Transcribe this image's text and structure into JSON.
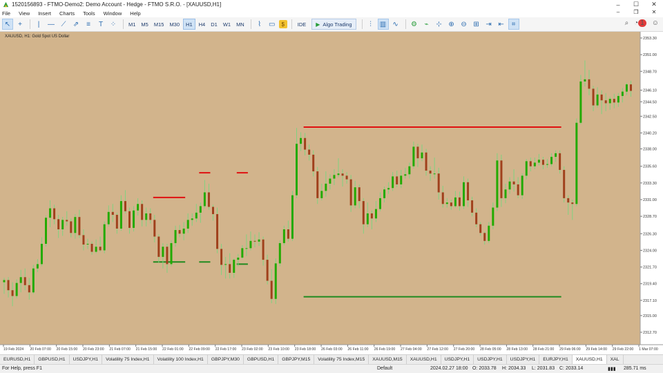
{
  "window": {
    "title": "1520156893 - FTMO-Demo2: Demo Account - Hedge - FTMO S.R.O. - [XAUUSD,H1]",
    "controls": [
      "–",
      "☐",
      "✕"
    ]
  },
  "menu": {
    "items": [
      "File",
      "View",
      "Insert",
      "Charts",
      "Tools",
      "Window",
      "Help"
    ],
    "right_controls": [
      "–",
      "❐",
      "✕"
    ]
  },
  "toolbar": {
    "timeframes": [
      "M1",
      "M5",
      "M15",
      "M30",
      "H1",
      "H4",
      "D1",
      "W1",
      "MN"
    ],
    "active_timeframe": "H1",
    "ide_label": "IDE",
    "algo_label": "Algo Trading",
    "notification_count": "1"
  },
  "chart": {
    "symbol_label": "XAUUSD, H1:  Gold Spot US Dollar",
    "background": "#d2b48c",
    "bull_color": "#22aa00",
    "bear_color": "#a0401c",
    "wick_color": "#7fd27f",
    "price_levels": [
      "2353.30",
      "2351.00",
      "2348.70",
      "2346.10",
      "2344.50",
      "2342.50",
      "2340.20",
      "2338.00",
      "2335.60",
      "2333.30",
      "2331.00",
      "2328.70",
      "2326.30",
      "2324.00",
      "2321.70",
      "2319.40",
      "2317.10",
      "2315.00",
      "2312.70"
    ],
    "time_labels": [
      "19 Feb 2024",
      "20 Feb 07:00",
      "20 Feb 15:00",
      "20 Feb 23:00",
      "21 Feb 07:00",
      "21 Feb 15:00",
      "22 Feb 01:00",
      "22 Feb 09:00",
      "22 Feb 17:00",
      "23 Feb 02:00",
      "23 Feb 10:00",
      "23 Feb 18:00",
      "26 Feb 03:00",
      "26 Feb 11:00",
      "26 Feb 19:00",
      "27 Feb 04:00",
      "27 Feb 12:00",
      "27 Feb 20:00",
      "28 Feb 05:00",
      "28 Feb 13:00",
      "28 Feb 21:00",
      "29 Feb 06:00",
      "29 Feb 14:00",
      "29 Feb 22:00",
      "1 Mar 07:00"
    ],
    "candles": [
      {
        "o": 2319.6,
        "h": 2320.2,
        "l": 2318.0,
        "c": 2319.9
      },
      {
        "o": 2319.9,
        "h": 2320.3,
        "l": 2317.5,
        "c": 2318.5
      },
      {
        "o": 2318.5,
        "h": 2319.6,
        "l": 2316.3,
        "c": 2317.7
      },
      {
        "o": 2317.7,
        "h": 2320.0,
        "l": 2317.4,
        "c": 2319.5
      },
      {
        "o": 2319.5,
        "h": 2321.3,
        "l": 2318.2,
        "c": 2320.3
      },
      {
        "o": 2320.3,
        "h": 2321.5,
        "l": 2318.5,
        "c": 2319.2
      },
      {
        "o": 2319.2,
        "h": 2320.2,
        "l": 2317.2,
        "c": 2318.2
      },
      {
        "o": 2318.2,
        "h": 2322.0,
        "l": 2318.0,
        "c": 2321.5
      },
      {
        "o": 2321.5,
        "h": 2322.8,
        "l": 2321.0,
        "c": 2322.1
      },
      {
        "o": 2322.1,
        "h": 2325.8,
        "l": 2321.8,
        "c": 2324.9
      },
      {
        "o": 2324.9,
        "h": 2328.8,
        "l": 2324.5,
        "c": 2328.5
      },
      {
        "o": 2328.5,
        "h": 2330.9,
        "l": 2327.2,
        "c": 2329.8
      },
      {
        "o": 2329.8,
        "h": 2330.3,
        "l": 2327.6,
        "c": 2328.3
      },
      {
        "o": 2328.3,
        "h": 2328.9,
        "l": 2325.7,
        "c": 2326.9
      },
      {
        "o": 2326.9,
        "h": 2328.6,
        "l": 2326.0,
        "c": 2328.2
      },
      {
        "o": 2328.2,
        "h": 2329.4,
        "l": 2327.4,
        "c": 2328.0
      },
      {
        "o": 2328.0,
        "h": 2328.4,
        "l": 2325.8,
        "c": 2326.4
      },
      {
        "o": 2326.4,
        "h": 2329.0,
        "l": 2325.6,
        "c": 2328.6
      },
      {
        "o": 2328.6,
        "h": 2329.6,
        "l": 2325.7,
        "c": 2326.1
      },
      {
        "o": 2326.1,
        "h": 2326.9,
        "l": 2324.0,
        "c": 2324.8
      },
      {
        "o": 2324.8,
        "h": 2325.6,
        "l": 2324.2,
        "c": 2324.9
      },
      {
        "o": 2324.9,
        "h": 2325.2,
        "l": 2323.4,
        "c": 2323.8
      },
      {
        "o": 2323.8,
        "h": 2325.5,
        "l": 2323.6,
        "c": 2324.5
      },
      {
        "o": 2324.5,
        "h": 2325.9,
        "l": 2323.8,
        "c": 2324.0
      },
      {
        "o": 2324.0,
        "h": 2328.0,
        "l": 2323.6,
        "c": 2327.6
      },
      {
        "o": 2327.6,
        "h": 2330.2,
        "l": 2327.3,
        "c": 2329.3
      },
      {
        "o": 2329.3,
        "h": 2330.4,
        "l": 2327.9,
        "c": 2328.9
      },
      {
        "o": 2328.9,
        "h": 2329.2,
        "l": 2326.3,
        "c": 2327.0
      },
      {
        "o": 2327.0,
        "h": 2331.6,
        "l": 2326.7,
        "c": 2330.8
      },
      {
        "o": 2330.8,
        "h": 2332.3,
        "l": 2329.1,
        "c": 2329.4
      },
      {
        "o": 2329.4,
        "h": 2329.9,
        "l": 2326.3,
        "c": 2327.1
      },
      {
        "o": 2327.1,
        "h": 2330.1,
        "l": 2326.6,
        "c": 2329.5
      },
      {
        "o": 2329.5,
        "h": 2331.2,
        "l": 2328.8,
        "c": 2330.4
      },
      {
        "o": 2330.4,
        "h": 2330.9,
        "l": 2327.3,
        "c": 2328.2
      },
      {
        "o": 2328.2,
        "h": 2329.9,
        "l": 2327.3,
        "c": 2329.1
      },
      {
        "o": 2329.1,
        "h": 2329.8,
        "l": 2327.7,
        "c": 2328.2
      },
      {
        "o": 2328.2,
        "h": 2328.9,
        "l": 2325.1,
        "c": 2325.9
      },
      {
        "o": 2325.9,
        "h": 2326.2,
        "l": 2322.3,
        "c": 2323.1
      },
      {
        "o": 2323.1,
        "h": 2325.0,
        "l": 2321.5,
        "c": 2324.5
      },
      {
        "o": 2324.5,
        "h": 2324.9,
        "l": 2320.9,
        "c": 2322.1
      },
      {
        "o": 2322.1,
        "h": 2325.4,
        "l": 2321.8,
        "c": 2325.0
      },
      {
        "o": 2325.0,
        "h": 2327.4,
        "l": 2324.5,
        "c": 2326.8
      },
      {
        "o": 2326.8,
        "h": 2327.5,
        "l": 2325.8,
        "c": 2326.3
      },
      {
        "o": 2326.3,
        "h": 2327.9,
        "l": 2325.4,
        "c": 2327.0
      },
      {
        "o": 2327.0,
        "h": 2329.1,
        "l": 2326.4,
        "c": 2328.2
      },
      {
        "o": 2328.2,
        "h": 2329.1,
        "l": 2327.4,
        "c": 2328.4
      },
      {
        "o": 2328.4,
        "h": 2330.4,
        "l": 2327.9,
        "c": 2329.2
      },
      {
        "o": 2329.2,
        "h": 2330.6,
        "l": 2327.8,
        "c": 2330.1
      },
      {
        "o": 2330.1,
        "h": 2333.7,
        "l": 2329.8,
        "c": 2332.0
      },
      {
        "o": 2332.0,
        "h": 2333.2,
        "l": 2329.6,
        "c": 2330.0
      },
      {
        "o": 2330.0,
        "h": 2330.3,
        "l": 2328.1,
        "c": 2329.0
      },
      {
        "o": 2329.0,
        "h": 2329.9,
        "l": 2323.6,
        "c": 2324.2
      },
      {
        "o": 2324.2,
        "h": 2324.9,
        "l": 2320.6,
        "c": 2322.0
      },
      {
        "o": 2322.0,
        "h": 2323.1,
        "l": 2320.1,
        "c": 2322.1
      },
      {
        "o": 2322.1,
        "h": 2323.6,
        "l": 2320.1,
        "c": 2320.9
      },
      {
        "o": 2320.9,
        "h": 2322.9,
        "l": 2320.2,
        "c": 2322.7
      },
      {
        "o": 2322.7,
        "h": 2323.5,
        "l": 2321.8,
        "c": 2323.0
      },
      {
        "o": 2323.0,
        "h": 2324.7,
        "l": 2322.8,
        "c": 2324.3
      },
      {
        "o": 2324.3,
        "h": 2326.2,
        "l": 2323.2,
        "c": 2324.3
      },
      {
        "o": 2324.3,
        "h": 2326.6,
        "l": 2324.0,
        "c": 2325.3
      },
      {
        "o": 2325.3,
        "h": 2326.2,
        "l": 2324.4,
        "c": 2325.2
      },
      {
        "o": 2325.2,
        "h": 2326.5,
        "l": 2324.6,
        "c": 2325.5
      },
      {
        "o": 2325.5,
        "h": 2325.9,
        "l": 2321.9,
        "c": 2322.7
      },
      {
        "o": 2322.7,
        "h": 2323.4,
        "l": 2319.3,
        "c": 2319.8
      },
      {
        "o": 2319.8,
        "h": 2321.4,
        "l": 2316.7,
        "c": 2317.3
      },
      {
        "o": 2317.3,
        "h": 2322.9,
        "l": 2316.6,
        "c": 2322.2
      },
      {
        "o": 2322.2,
        "h": 2325.4,
        "l": 2321.8,
        "c": 2325.0
      },
      {
        "o": 2325.0,
        "h": 2327.4,
        "l": 2324.7,
        "c": 2326.9
      },
      {
        "o": 2326.9,
        "h": 2328.1,
        "l": 2325.2,
        "c": 2325.6
      },
      {
        "o": 2325.6,
        "h": 2332.2,
        "l": 2325.3,
        "c": 2331.6
      },
      {
        "o": 2331.6,
        "h": 2340.9,
        "l": 2331.2,
        "c": 2338.7
      },
      {
        "o": 2338.7,
        "h": 2340.3,
        "l": 2337.7,
        "c": 2339.5
      },
      {
        "o": 2339.5,
        "h": 2340.2,
        "l": 2337.1,
        "c": 2337.9
      },
      {
        "o": 2337.9,
        "h": 2338.6,
        "l": 2336.4,
        "c": 2337.2
      },
      {
        "o": 2337.2,
        "h": 2337.8,
        "l": 2334.2,
        "c": 2334.9
      },
      {
        "o": 2334.9,
        "h": 2335.5,
        "l": 2330.4,
        "c": 2331.2
      },
      {
        "o": 2331.2,
        "h": 2333.2,
        "l": 2330.9,
        "c": 2332.2
      },
      {
        "o": 2332.2,
        "h": 2334.9,
        "l": 2331.4,
        "c": 2333.2
      },
      {
        "o": 2333.2,
        "h": 2334.5,
        "l": 2332.4,
        "c": 2333.9
      },
      {
        "o": 2333.9,
        "h": 2335.2,
        "l": 2333.0,
        "c": 2334.4
      },
      {
        "o": 2334.4,
        "h": 2336.7,
        "l": 2334.1,
        "c": 2334.6
      },
      {
        "o": 2334.6,
        "h": 2335.2,
        "l": 2332.8,
        "c": 2334.3
      },
      {
        "o": 2334.3,
        "h": 2334.8,
        "l": 2333.2,
        "c": 2333.8
      },
      {
        "o": 2333.8,
        "h": 2334.4,
        "l": 2329.3,
        "c": 2330.2
      },
      {
        "o": 2330.2,
        "h": 2333.6,
        "l": 2329.8,
        "c": 2332.7
      },
      {
        "o": 2332.7,
        "h": 2333.1,
        "l": 2329.8,
        "c": 2330.8
      },
      {
        "o": 2330.8,
        "h": 2331.2,
        "l": 2326.3,
        "c": 2327.6
      },
      {
        "o": 2327.6,
        "h": 2330.6,
        "l": 2327.2,
        "c": 2329.1
      },
      {
        "o": 2329.1,
        "h": 2329.5,
        "l": 2326.9,
        "c": 2328.4
      },
      {
        "o": 2328.4,
        "h": 2330.8,
        "l": 2327.9,
        "c": 2329.7
      },
      {
        "o": 2329.7,
        "h": 2332.0,
        "l": 2329.4,
        "c": 2331.2
      },
      {
        "o": 2331.2,
        "h": 2332.8,
        "l": 2330.6,
        "c": 2332.4
      },
      {
        "o": 2332.4,
        "h": 2333.4,
        "l": 2331.8,
        "c": 2332.6
      },
      {
        "o": 2332.6,
        "h": 2334.8,
        "l": 2332.2,
        "c": 2334.2
      },
      {
        "o": 2334.2,
        "h": 2335.0,
        "l": 2332.7,
        "c": 2333.1
      },
      {
        "o": 2333.1,
        "h": 2335.1,
        "l": 2332.6,
        "c": 2334.3
      },
      {
        "o": 2334.3,
        "h": 2335.4,
        "l": 2333.9,
        "c": 2334.5
      },
      {
        "o": 2334.5,
        "h": 2336.1,
        "l": 2333.9,
        "c": 2335.6
      },
      {
        "o": 2335.6,
        "h": 2339.0,
        "l": 2335.3,
        "c": 2338.3
      },
      {
        "o": 2338.3,
        "h": 2338.7,
        "l": 2335.5,
        "c": 2336.7
      },
      {
        "o": 2336.7,
        "h": 2338.6,
        "l": 2336.3,
        "c": 2337.5
      },
      {
        "o": 2337.5,
        "h": 2338.0,
        "l": 2334.3,
        "c": 2335.0
      },
      {
        "o": 2335.0,
        "h": 2335.6,
        "l": 2333.6,
        "c": 2334.6
      },
      {
        "o": 2334.6,
        "h": 2336.8,
        "l": 2333.9,
        "c": 2334.6
      },
      {
        "o": 2334.6,
        "h": 2335.4,
        "l": 2331.0,
        "c": 2332.0
      },
      {
        "o": 2332.0,
        "h": 2332.9,
        "l": 2329.9,
        "c": 2330.4
      },
      {
        "o": 2330.4,
        "h": 2331.2,
        "l": 2329.9,
        "c": 2330.6
      },
      {
        "o": 2330.6,
        "h": 2331.0,
        "l": 2329.6,
        "c": 2330.1
      },
      {
        "o": 2330.1,
        "h": 2332.2,
        "l": 2329.9,
        "c": 2331.3
      },
      {
        "o": 2331.3,
        "h": 2332.1,
        "l": 2329.5,
        "c": 2330.1
      },
      {
        "o": 2330.1,
        "h": 2334.2,
        "l": 2329.7,
        "c": 2333.4
      },
      {
        "o": 2333.4,
        "h": 2333.9,
        "l": 2330.0,
        "c": 2330.9
      },
      {
        "o": 2330.9,
        "h": 2331.4,
        "l": 2328.7,
        "c": 2329.2
      },
      {
        "o": 2329.2,
        "h": 2329.8,
        "l": 2327.2,
        "c": 2327.6
      },
      {
        "o": 2327.6,
        "h": 2327.9,
        "l": 2326.0,
        "c": 2326.4
      },
      {
        "o": 2326.4,
        "h": 2326.6,
        "l": 2324.8,
        "c": 2325.3
      },
      {
        "o": 2325.3,
        "h": 2327.9,
        "l": 2325.0,
        "c": 2327.4
      },
      {
        "o": 2327.4,
        "h": 2330.6,
        "l": 2326.9,
        "c": 2329.9
      },
      {
        "o": 2329.9,
        "h": 2337.4,
        "l": 2329.4,
        "c": 2336.4
      },
      {
        "o": 2336.4,
        "h": 2337.2,
        "l": 2330.0,
        "c": 2331.2
      },
      {
        "o": 2331.2,
        "h": 2333.2,
        "l": 2330.5,
        "c": 2332.4
      },
      {
        "o": 2332.4,
        "h": 2334.1,
        "l": 2331.8,
        "c": 2333.5
      },
      {
        "o": 2333.5,
        "h": 2335.2,
        "l": 2332.1,
        "c": 2333.1
      },
      {
        "o": 2333.1,
        "h": 2334.1,
        "l": 2331.2,
        "c": 2331.6
      },
      {
        "o": 2331.6,
        "h": 2334.6,
        "l": 2331.1,
        "c": 2334.3
      },
      {
        "o": 2334.3,
        "h": 2336.6,
        "l": 2333.8,
        "c": 2336.3
      },
      {
        "o": 2336.3,
        "h": 2336.8,
        "l": 2334.9,
        "c": 2335.6
      },
      {
        "o": 2335.6,
        "h": 2336.8,
        "l": 2335.2,
        "c": 2336.1
      },
      {
        "o": 2336.1,
        "h": 2337.3,
        "l": 2335.7,
        "c": 2336.5
      },
      {
        "o": 2336.5,
        "h": 2336.9,
        "l": 2335.2,
        "c": 2335.8
      },
      {
        "o": 2335.8,
        "h": 2336.6,
        "l": 2335.4,
        "c": 2335.9
      },
      {
        "o": 2335.9,
        "h": 2337.4,
        "l": 2335.6,
        "c": 2336.9
      },
      {
        "o": 2336.9,
        "h": 2337.8,
        "l": 2336.2,
        "c": 2337.4
      },
      {
        "o": 2337.4,
        "h": 2337.8,
        "l": 2334.6,
        "c": 2335.1
      },
      {
        "o": 2335.1,
        "h": 2335.6,
        "l": 2330.6,
        "c": 2331.2
      },
      {
        "o": 2331.2,
        "h": 2331.6,
        "l": 2328.9,
        "c": 2330.6
      },
      {
        "o": 2330.6,
        "h": 2331.0,
        "l": 2328.2,
        "c": 2330.4
      },
      {
        "o": 2330.4,
        "h": 2342.2,
        "l": 2330.1,
        "c": 2341.6
      },
      {
        "o": 2341.6,
        "h": 2348.2,
        "l": 2341.4,
        "c": 2347.3
      },
      {
        "o": 2347.3,
        "h": 2350.2,
        "l": 2346.6,
        "c": 2347.6
      },
      {
        "o": 2347.6,
        "h": 2348.9,
        "l": 2345.4,
        "c": 2346.3
      },
      {
        "o": 2346.3,
        "h": 2346.7,
        "l": 2343.2,
        "c": 2344.0
      },
      {
        "o": 2344.0,
        "h": 2346.5,
        "l": 2343.7,
        "c": 2345.5
      },
      {
        "o": 2345.5,
        "h": 2346.1,
        "l": 2342.8,
        "c": 2344.7
      },
      {
        "o": 2344.7,
        "h": 2345.7,
        "l": 2343.2,
        "c": 2344.3
      },
      {
        "o": 2344.3,
        "h": 2345.2,
        "l": 2343.4,
        "c": 2344.9
      },
      {
        "o": 2344.9,
        "h": 2345.6,
        "l": 2343.6,
        "c": 2344.4
      },
      {
        "o": 2344.4,
        "h": 2345.7,
        "l": 2343.8,
        "c": 2345.3
      },
      {
        "o": 2345.3,
        "h": 2346.4,
        "l": 2344.4,
        "c": 2345.9
      },
      {
        "o": 2345.9,
        "h": 2347.1,
        "l": 2345.4,
        "c": 2346.9
      },
      {
        "o": 2346.9,
        "h": 2347.4,
        "l": 2345.2,
        "c": 2346.0
      }
    ],
    "levels": [
      {
        "price": 2331.3,
        "from": 36,
        "to": 43,
        "color": "#e01010"
      },
      {
        "price": 2334.7,
        "from": 47,
        "to": 49,
        "color": "#e01010"
      },
      {
        "price": 2334.7,
        "from": 56,
        "to": 58,
        "color": "#e01010"
      },
      {
        "price": 2341.0,
        "from": 72,
        "to": 133,
        "color": "#e01010"
      },
      {
        "price": 2322.4,
        "from": 36,
        "to": 43,
        "color": "#1f8a1f"
      },
      {
        "price": 2322.4,
        "from": 47,
        "to": 49,
        "color": "#1f8a1f"
      },
      {
        "price": 2322.1,
        "from": 56,
        "to": 58,
        "color": "#1f8a1f"
      },
      {
        "price": 2317.6,
        "from": 72,
        "to": 133,
        "color": "#1f8a1f"
      }
    ]
  },
  "tabs": [
    "EURUSD,H1",
    "GBPUSD,H1",
    "USDJPY,H1",
    "Volatility 75 Index,H1",
    "Volatility 100 Index,H1",
    "GBPJPY,M30",
    "GBPUSD,H1",
    "GBPJPY,M15",
    "Volatility 75 Index,M15",
    "XAUUSD,M15",
    "XAUUSD,H1",
    "USDJPY,H1",
    "USDJPY,H1",
    "USDJPY,H1",
    "EURJPY,H1",
    "XAUUSD,H1",
    "XAL"
  ],
  "active_tab_index": 15,
  "status": {
    "help": "For Help, press F1",
    "profile": "Default",
    "datetime": "2024.02.27 18:00",
    "open": "O: 2033.78",
    "high": "H: 2034.33",
    "low": "L: 2031.83",
    "close": "C: 2033.14",
    "ping": "285.71 ms"
  }
}
